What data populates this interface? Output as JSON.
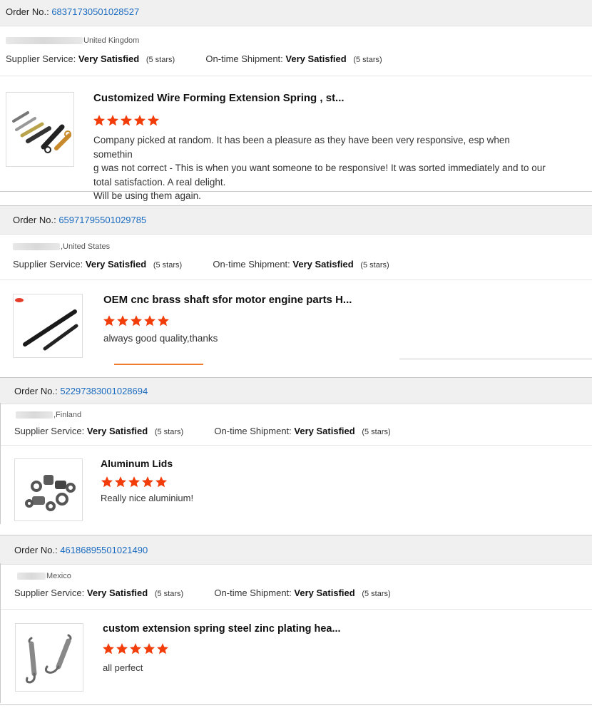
{
  "labels": {
    "order_no": "Order No.:",
    "supplier_service": "Supplier Service:",
    "ontime_shipment": "On-time Shipment:"
  },
  "colors": {
    "star": "#f23d0a",
    "order_link": "#1a6bbf",
    "accent_line": "#f27a2e"
  },
  "orders": [
    {
      "order_number": "68371730501028527",
      "country": "United Kingdom",
      "supplier_rating": "Very Satisfied",
      "supplier_stars": "(5 stars)",
      "shipment_rating": "Very Satisfied",
      "shipment_stars": "(5 stars)",
      "product_title": "Customized Wire Forming Extension Spring , st...",
      "rating": 5,
      "review_lines": [
        "Company picked at random. It has been a pleasure as they have been very responsive, esp when somethin",
        "g was not correct - This is when you want someone to be responsive! It was sorted immediately and to our",
        "total satisfaction. A real delight.",
        "Will be using them again."
      ],
      "image_icon": "springs-image"
    },
    {
      "order_number": "65971795501029785",
      "country": ",United States",
      "supplier_rating": "Very Satisfied",
      "supplier_stars": "(5 stars)",
      "shipment_rating": "Very Satisfied",
      "shipment_stars": "(5 stars)",
      "product_title": "OEM cnc brass shaft sfor motor engine parts H...",
      "rating": 5,
      "review_lines": [
        "always good quality,thanks"
      ],
      "image_icon": "shafts-image"
    },
    {
      "order_number": "52297383001028694",
      "country": ",Finland",
      "supplier_rating": "Very Satisfied",
      "supplier_stars": "(5 stars)",
      "shipment_rating": "Very Satisfied",
      "shipment_stars": "(5 stars)",
      "product_title": "Aluminum Lids",
      "rating": 5,
      "review_lines": [
        "Really nice aluminium!"
      ],
      "image_icon": "washers-image"
    },
    {
      "order_number": "46186895501021490",
      "country": "Mexico",
      "supplier_rating": "Very Satisfied",
      "supplier_stars": "(5 stars)",
      "shipment_rating": "Very Satisfied",
      "shipment_stars": "(5 stars)",
      "product_title": "custom extension spring steel zinc plating hea...",
      "rating": 5,
      "review_lines": [
        "all perfect"
      ],
      "image_icon": "hook-springs-image"
    }
  ]
}
